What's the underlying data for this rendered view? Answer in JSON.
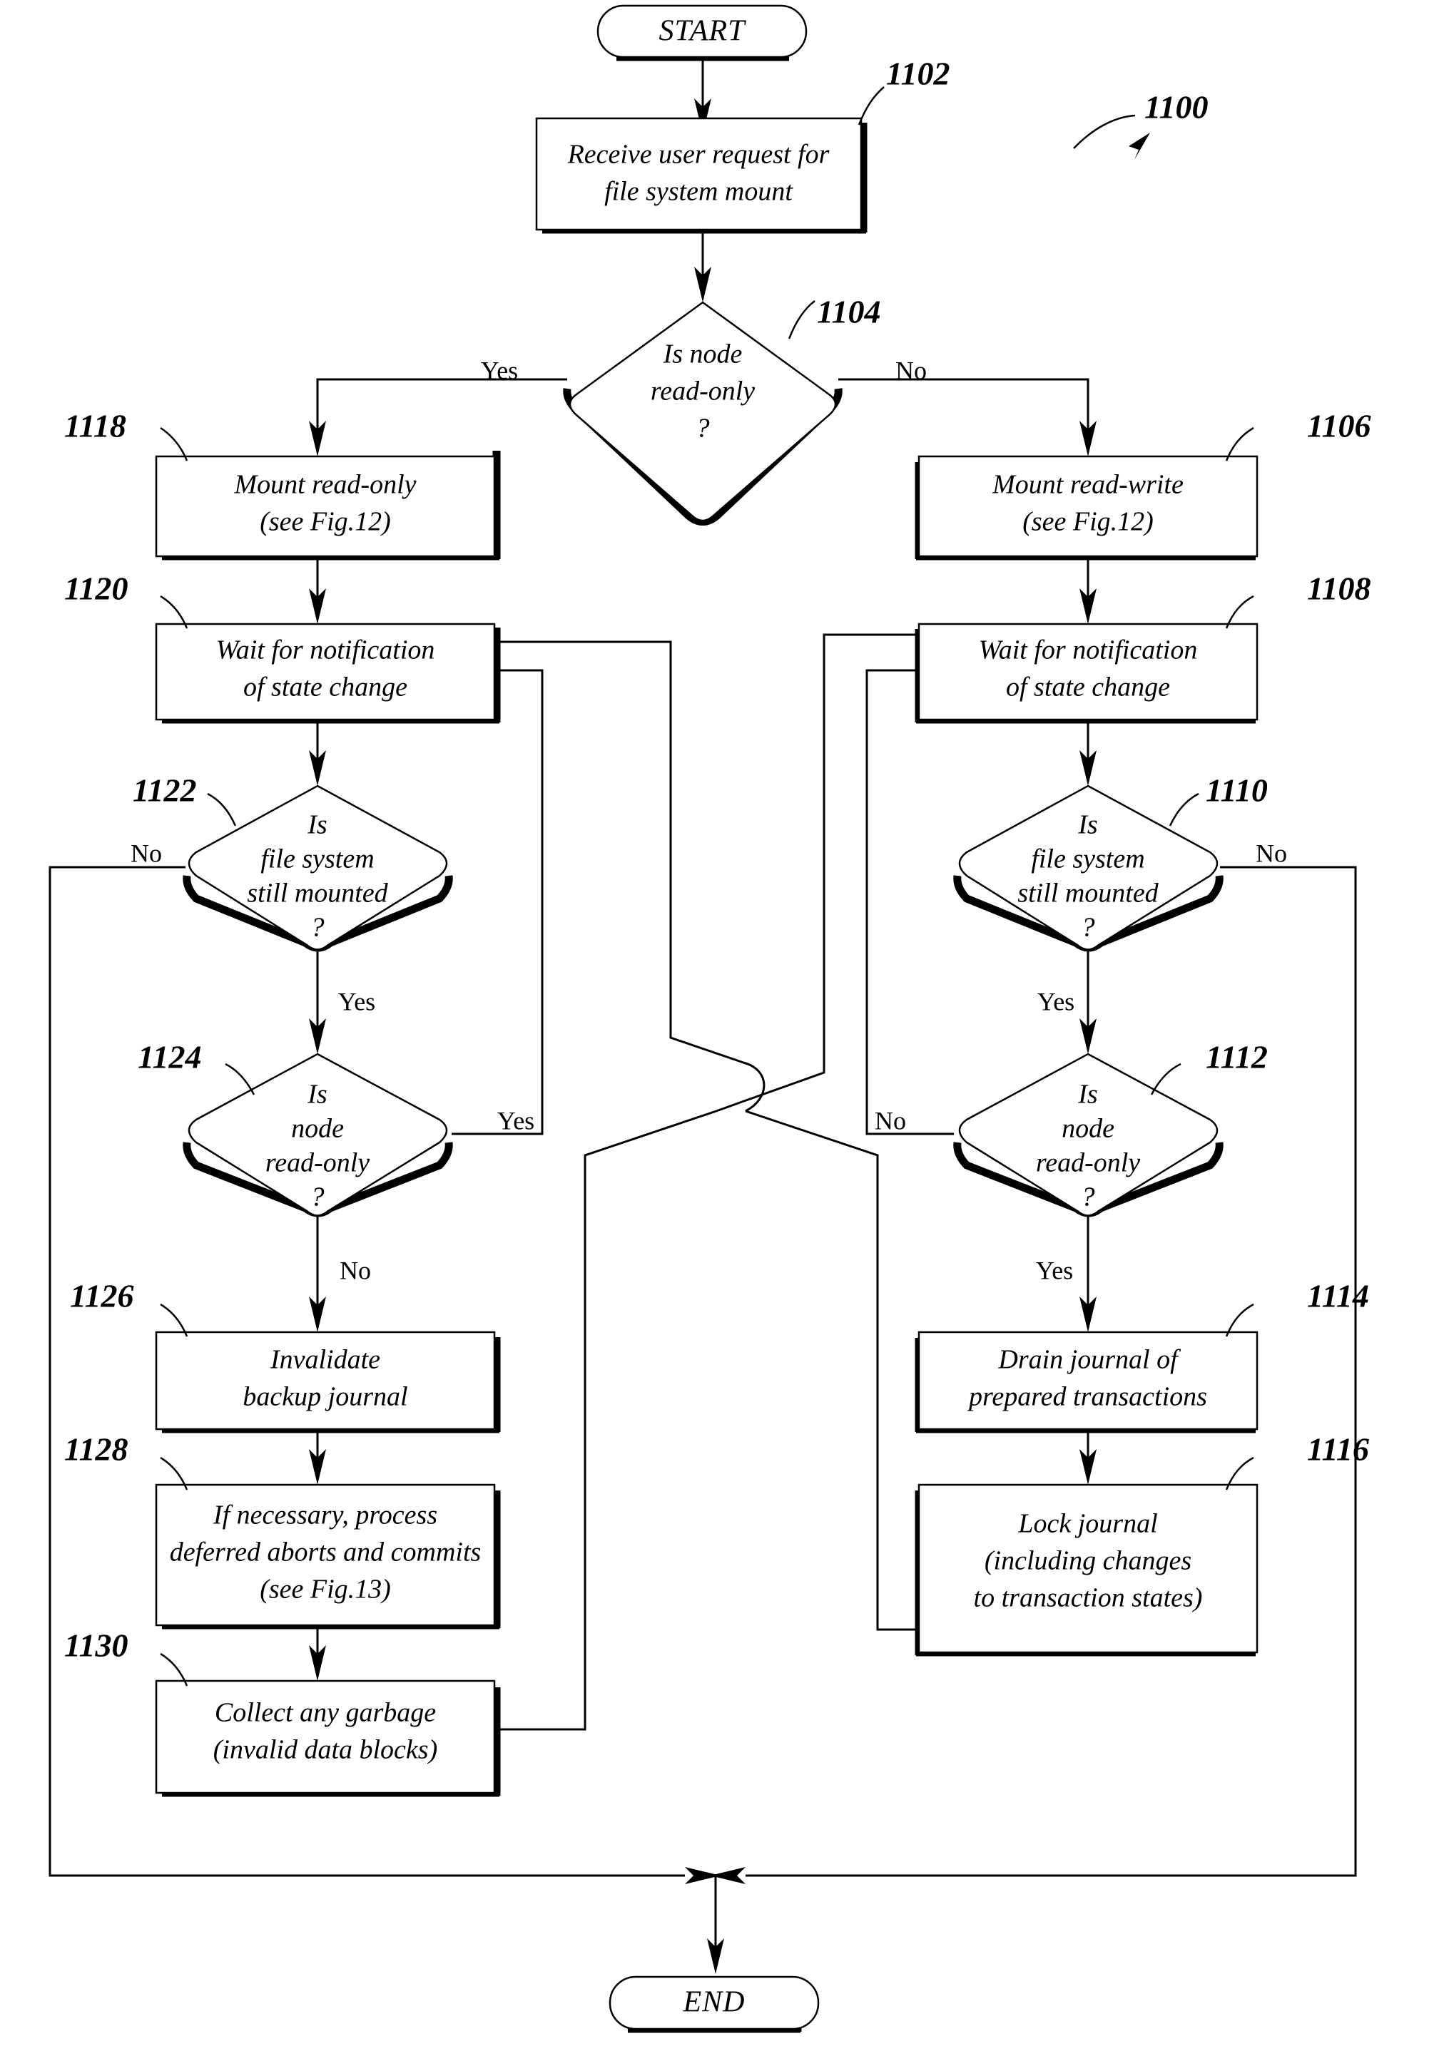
{
  "figure": {
    "figure_ref": "1100",
    "terminals": {
      "start": "START",
      "end": "END"
    },
    "branch_labels": {
      "yes": "Yes",
      "no": "No"
    },
    "nodes": [
      {
        "id": "1102",
        "ref": "1102",
        "type": "process",
        "lines": [
          "Receive user request for",
          "file system mount"
        ]
      },
      {
        "id": "1104",
        "ref": "1104",
        "type": "decision",
        "lines": [
          "Is node",
          "read-only",
          "?"
        ]
      },
      {
        "id": "1106",
        "ref": "1106",
        "type": "process",
        "lines": [
          "Mount read-write",
          "(see Fig.12)"
        ]
      },
      {
        "id": "1108",
        "ref": "1108",
        "type": "process",
        "lines": [
          "Wait for notification",
          "of state change"
        ]
      },
      {
        "id": "1110",
        "ref": "1110",
        "type": "decision",
        "lines": [
          "Is",
          "file system",
          "still mounted",
          "?"
        ]
      },
      {
        "id": "1112",
        "ref": "1112",
        "type": "decision",
        "lines": [
          "Is",
          "node",
          "read-only",
          "?"
        ]
      },
      {
        "id": "1114",
        "ref": "1114",
        "type": "process",
        "lines": [
          "Drain journal of",
          "prepared transactions"
        ]
      },
      {
        "id": "1116",
        "ref": "1116",
        "type": "process",
        "lines": [
          "Lock journal",
          "(including changes",
          "to transaction states)"
        ]
      },
      {
        "id": "1118",
        "ref": "1118",
        "type": "process",
        "lines": [
          "Mount read-only",
          "(see Fig.12)"
        ]
      },
      {
        "id": "1120",
        "ref": "1120",
        "type": "process",
        "lines": [
          "Wait for notification",
          "of state change"
        ]
      },
      {
        "id": "1122",
        "ref": "1122",
        "type": "decision",
        "lines": [
          "Is",
          "file system",
          "still mounted",
          "?"
        ]
      },
      {
        "id": "1124",
        "ref": "1124",
        "type": "decision",
        "lines": [
          "Is",
          "node",
          "read-only",
          "?"
        ]
      },
      {
        "id": "1126",
        "ref": "1126",
        "type": "process",
        "lines": [
          "Invalidate",
          "backup journal"
        ]
      },
      {
        "id": "1128",
        "ref": "1128",
        "type": "process",
        "lines": [
          "If necessary, process",
          "deferred aborts and commits",
          "(see Fig.13)"
        ]
      },
      {
        "id": "1130",
        "ref": "1130",
        "type": "process",
        "lines": [
          "Collect any garbage",
          "(invalid data blocks)"
        ]
      }
    ]
  },
  "colors": {
    "ink": "#000000",
    "paper": "#ffffff"
  }
}
